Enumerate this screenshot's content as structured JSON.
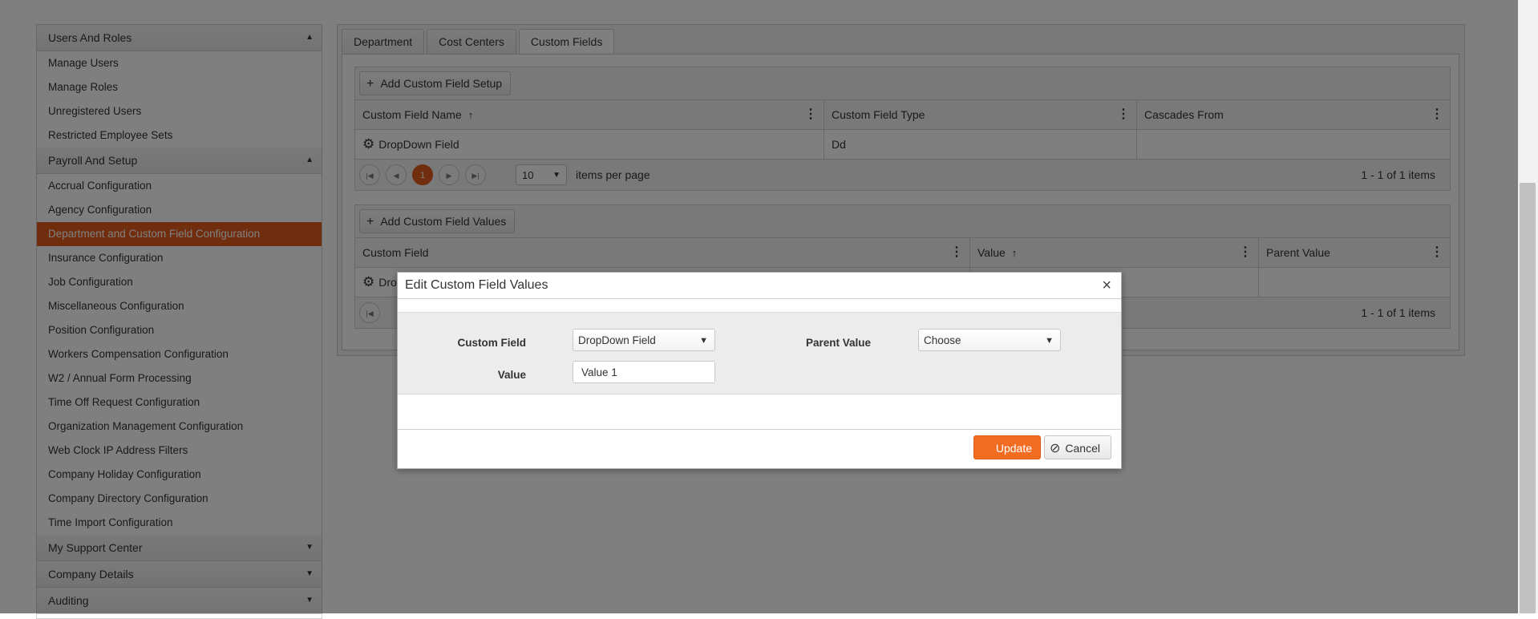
{
  "sidebar": {
    "sections": [
      {
        "title": "Users And Roles",
        "caret": "▲",
        "items": [
          "Manage Users",
          "Manage Roles",
          "Unregistered Users",
          "Restricted Employee Sets"
        ]
      },
      {
        "title": "Payroll And Setup",
        "caret": "▲",
        "items": [
          "Accrual Configuration",
          "Agency Configuration",
          "Department and Custom Field Configuration",
          "Insurance Configuration",
          "Job Configuration",
          "Miscellaneous Configuration",
          "Position Configuration",
          "Workers Compensation Configuration",
          "W2 / Annual Form Processing",
          "Time Off Request Configuration",
          "Organization Management Configuration",
          "Web Clock IP Address Filters",
          "Company Holiday Configuration",
          "Company Directory Configuration",
          "Time Import Configuration"
        ]
      },
      {
        "title": "My Support Center",
        "caret": "▼",
        "items": []
      },
      {
        "title": "Company Details",
        "caret": "▼",
        "items": []
      },
      {
        "title": "Auditing",
        "caret": "▼",
        "items": []
      }
    ],
    "active_item": "Department and Custom Field Configuration"
  },
  "tabs": [
    "Department",
    "Cost Centers",
    "Custom Fields"
  ],
  "active_tab": "Custom Fields",
  "setup_grid": {
    "add_label": "Add Custom Field Setup",
    "columns": [
      "Custom Field Name",
      "Custom Field Type",
      "Cascades From"
    ],
    "rows": [
      [
        "DropDown Field",
        "Dd",
        ""
      ]
    ],
    "pager": {
      "page": "1",
      "page_size": "10",
      "per_page_label": "items per page",
      "info": "1 - 1 of 1 items"
    }
  },
  "values_grid": {
    "add_label": "Add Custom Field Values",
    "columns": [
      "Custom Field",
      "Value",
      "Parent Value"
    ],
    "rows": [
      [
        "Dro",
        "",
        ""
      ]
    ],
    "pager": {
      "info": "1 - 1 of 1 items"
    }
  },
  "dialog": {
    "title": "Edit Custom Field Values",
    "close": "×",
    "custom_field_label": "Custom Field",
    "custom_field_value": "DropDown Field",
    "parent_value_label": "Parent Value",
    "parent_value_value": "Choose",
    "value_label": "Value",
    "value_value": "Value 1",
    "update_label": "Update",
    "cancel_label": "Cancel"
  },
  "colors": {
    "accent": "#e25c1d",
    "update_button": "#f26c22"
  }
}
